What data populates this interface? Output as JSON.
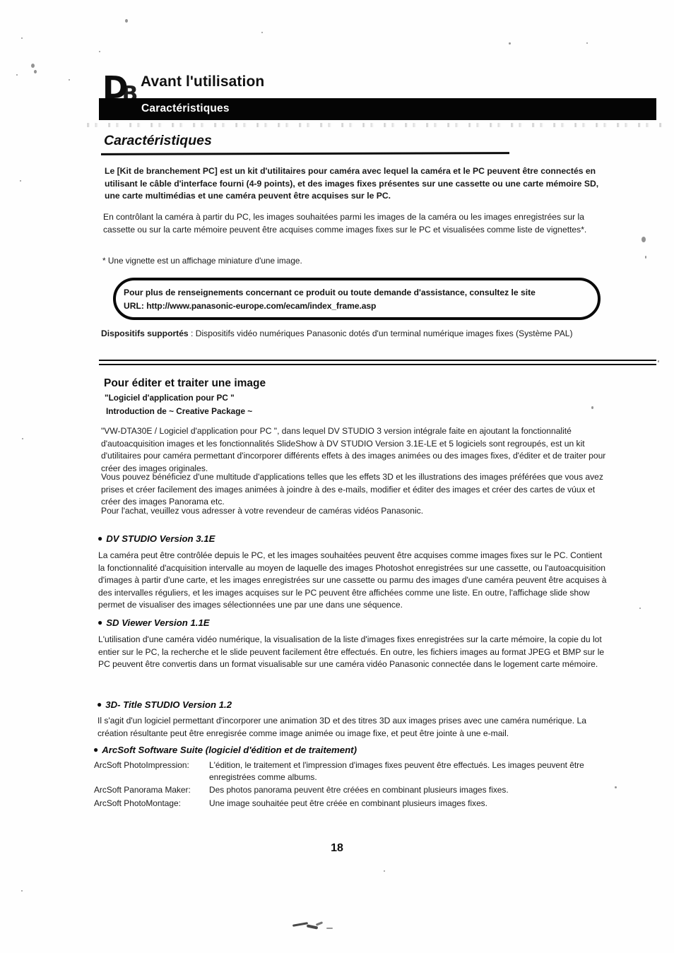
{
  "header": {
    "logo_letter": "D",
    "logo_letter_sub": "B",
    "chapter_title": "Avant l'utilisation",
    "bar_label": "Caractéristiques",
    "section_title": "Caractéristiques"
  },
  "intro": {
    "paragraph_1": "Le [Kit de branchement PC] est un kit d'utilitaires pour caméra avec lequel la caméra et le PC peuvent être connectés en utilisant le câble d'interface fourni (4-9 points), et des images fixes présentes sur une cassette ou une carte mémoire SD, une carte multimédias et une caméra peuvent être acquises sur le PC.",
    "paragraph_2": "En contrôlant la caméra à partir du PC, les images souhaitées parmi les images de la caméra ou les images enregistrées sur la cassette ou sur la carte mémoire peuvent être acquises comme images fixes sur le PC et visualisées comme liste de vignettes*.",
    "footnote": "* Une vignette est un affichage miniature d'une image."
  },
  "callout": {
    "line_1": "Pour plus de renseignements concernant ce produit ou toute demande d'assistance, consultez le site",
    "line_2_label": "URL:",
    "line_2_url": "http://www.panasonic-europe.com/ecam/index_frame.asp"
  },
  "supported": {
    "label": "Dispositifs supportés",
    "separator": " : ",
    "value": "Dispositifs vidéo numériques Panasonic dotés d'un terminal numérique images fixes (Système PAL)"
  },
  "editing": {
    "heading": "Pour éditer et traiter une image",
    "subheading_1": "\"Logiciel d'application pour PC \"",
    "subheading_2": "Introduction de ~ Creative Package ~",
    "paragraph_1": "\"VW-DTA30E / Logiciel d'application pour PC \", dans lequel DV STUDIO 3 version intégrale faite en ajoutant la fonctionnalité d'autoacquisition images et les fonctionnalités SlideShow à DV STUDIO Version 3.1E-LE et 5 logiciels sont regroupés, est un kit d'utilitaires pour caméra permettant d'incorporer différents effets à des images animées ou des images fixes, d'éditer et de traiter pour créer des images originales.",
    "paragraph_2": "Vous pouvez bénéficiez d'une multitude d'applications telles que les effets 3D et les illustrations des images préférées que vous avez prises et créer facilement des images animées à joindre à des e-mails, modifier et éditer des images et créer des cartes de vúux et créer des images Panorama etc.",
    "paragraph_3": "Pour l'achat, veuillez vous adresser à votre revendeur de caméras vidéos Panasonic."
  },
  "products": [
    {
      "title": "DV STUDIO Version 3.1E",
      "body": "La caméra peut être contrôlée depuis le PC, et les images souhaitées peuvent être acquises comme images fixes sur le PC. Contient la fonctionnalité d'acquisition intervalle au moyen de laquelle des images Photoshot enregistrées sur une cassette, ou l'autoacquisition d'images à partir d'une carte, et les images enregistrées sur une cassette ou parmu des images d'une caméra peuvent être acquises à des intervalles réguliers, et les images acquises sur le PC peuvent être affichées comme une liste. En outre, l'affichage slide show permet de visualiser des images sélectionnées une par une dans une séquence."
    },
    {
      "title": "SD Viewer Version 1.1E",
      "body": "L'utilisation d'une caméra vidéo numérique, la visualisation de la liste d'images fixes enregistrées sur la carte mémoire, la copie du lot entier sur le PC, la recherche et le slide peuvent facilement être effectués. En outre, les fichiers images au format JPEG et BMP sur le PC peuvent être convertis dans un format visualisable sur une caméra vidéo Panasonic connectée dans le logement carte mémoire."
    },
    {
      "title": "3D- Title STUDIO Version 1.2",
      "body": "Il s'agit d'un logiciel permettant d'incorporer une animation 3D et des titres 3D aux images prises avec une caméra numérique. La création résultante peut être enregisrée comme image animée ou image fixe, et peut être jointe à une e-mail."
    }
  ],
  "arcsoft": {
    "title": "ArcSoft Software Suite (logiciel d'édition et de traitement)",
    "rows": [
      {
        "label": "ArcSoft PhotoImpression:",
        "desc": "L'édition, le traitement et l'impression d'images fixes peuvent être effectués. Les images peuvent être enregistrées comme albums."
      },
      {
        "label": "ArcSoft Panorama Maker:",
        "desc": "Des photos panorama peuvent être créées en combinant plusieurs images fixes."
      },
      {
        "label": "ArcSoft PhotoMontage:",
        "desc": "Une image souhaitée peut être créée en combinant plusieurs images fixes."
      }
    ]
  },
  "footer": {
    "page_number": "18"
  }
}
